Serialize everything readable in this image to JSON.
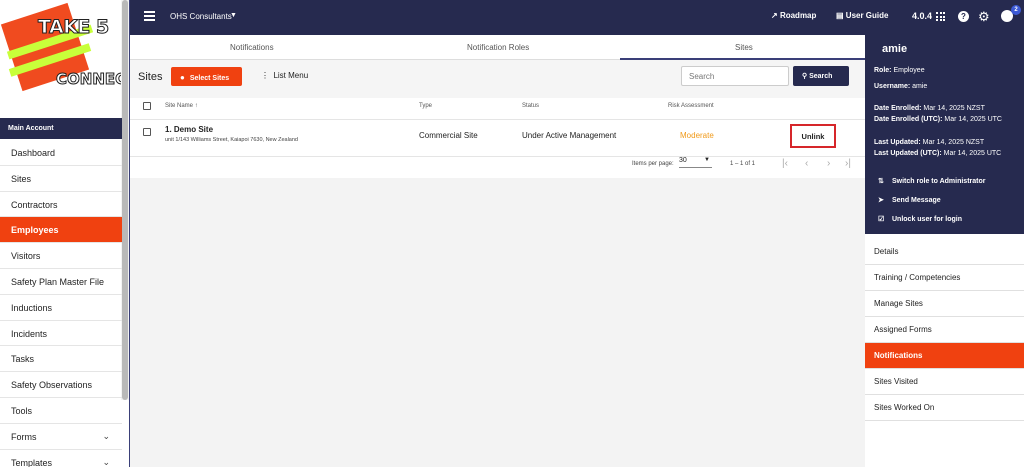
{
  "brand": {
    "logo_top": "TAKE 5",
    "logo_bottom": "CONNECT"
  },
  "sidebar": {
    "section_title": "Main Account",
    "items": [
      {
        "label": "Dashboard"
      },
      {
        "label": "Sites"
      },
      {
        "label": "Contractors"
      },
      {
        "label": "Employees",
        "active": true
      },
      {
        "label": "Visitors"
      },
      {
        "label": "Safety Plan Master File"
      },
      {
        "label": "Inductions"
      },
      {
        "label": "Incidents"
      },
      {
        "label": "Tasks"
      },
      {
        "label": "Safety Observations"
      },
      {
        "label": "Tools"
      },
      {
        "label": "Forms",
        "expandable": true
      },
      {
        "label": "Templates",
        "expandable": true
      }
    ]
  },
  "topbar": {
    "org_name": "OHS Consultants",
    "roadmap_label": "Roadmap",
    "guide_label": "User Guide",
    "version": "4.0.4",
    "notification_count": "2"
  },
  "tabs": [
    {
      "label": "Notifications"
    },
    {
      "label": "Notification Roles"
    },
    {
      "label": "Sites",
      "active": true
    }
  ],
  "toolbar": {
    "title": "Sites",
    "select_sites_label": "Select Sites",
    "list_menu_label": "List Menu",
    "search_placeholder": "Search",
    "search_button_label": "Search"
  },
  "table": {
    "headers": [
      "Site Name",
      "Type",
      "Status",
      "Risk Assessment"
    ],
    "sort_arrow": "↑",
    "rows": [
      {
        "name": "1. Demo Site",
        "address": "unit 1/143 Williams Street, Kaiapoi 7630, New Zealand",
        "type": "Commercial Site",
        "status": "Under Active Management",
        "risk": "Moderate",
        "action": "Unlink"
      }
    ],
    "pagination": {
      "items_per_page_label": "Items per page:",
      "items_per_page": "30",
      "range": "1 – 1 of 1"
    }
  },
  "user_panel": {
    "name": "amie",
    "role_label": "Role:",
    "role": "Employee",
    "username_label": "Username:",
    "username": "amie",
    "enrolled_label": "Date Enrolled:",
    "enrolled": "Mar 14, 2025 NZST",
    "enrolled_utc_label": "Date Enrolled (UTC):",
    "enrolled_utc": "Mar 14, 2025 UTC",
    "updated_label": "Last Updated:",
    "updated": "Mar 14, 2025 NZST",
    "updated_utc_label": "Last Updated (UTC):",
    "updated_utc": "Mar 14, 2025 UTC",
    "actions": [
      "Switch role to Administrator",
      "Send Message",
      "Unlock user for login"
    ]
  },
  "right_nav": [
    {
      "label": "Details"
    },
    {
      "label": "Training / Competencies"
    },
    {
      "label": "Manage Sites"
    },
    {
      "label": "Assigned Forms"
    },
    {
      "label": "Notifications",
      "active": true
    },
    {
      "label": "Sites Visited"
    },
    {
      "label": "Sites Worked On"
    }
  ],
  "colors": {
    "navy": "#262a4f",
    "accent": "#f04110",
    "risk_moderate": "#f09a1a",
    "highlight": "#d6262a"
  }
}
